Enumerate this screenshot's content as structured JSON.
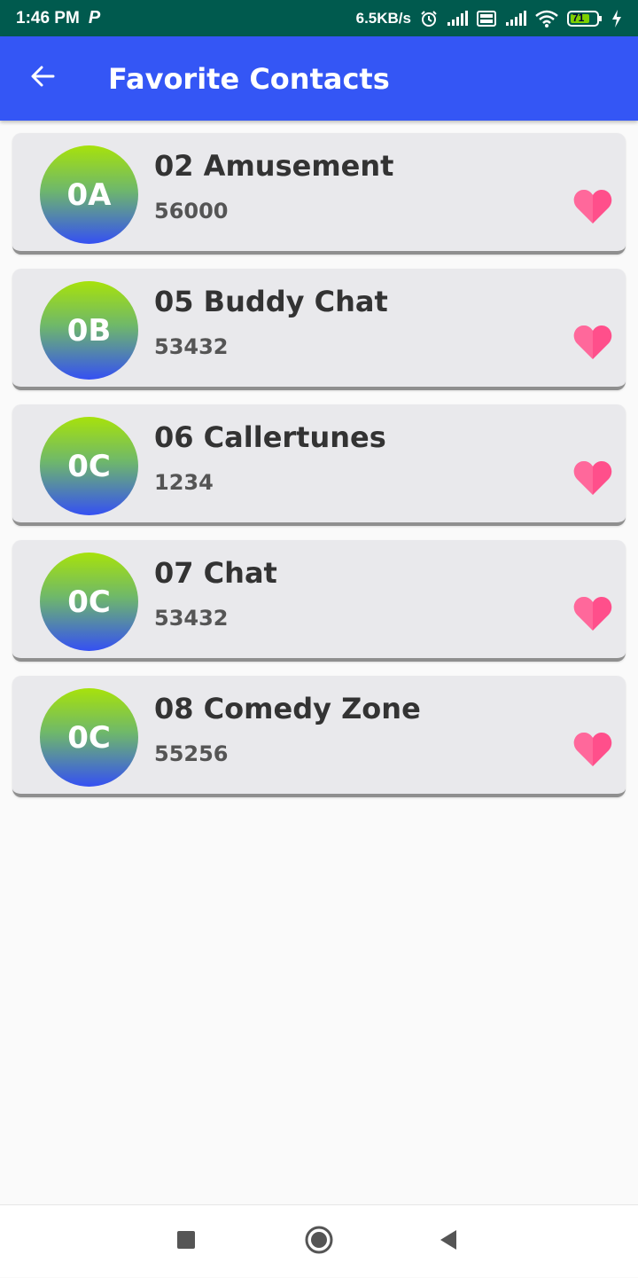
{
  "status_bar": {
    "time": "1:46 PM",
    "p_badge": "P",
    "network_speed": "6.5KB/s",
    "battery": "71",
    "icons": [
      "alarm-icon",
      "signal-icon",
      "volte-icon",
      "signal-icon",
      "wifi-icon",
      "battery-icon",
      "charging-icon"
    ]
  },
  "app_bar": {
    "title": "Favorite Contacts",
    "back_icon": "arrow-left-icon",
    "color": "#3456f5"
  },
  "contacts": [
    {
      "initials": "0A",
      "name": "02 Amusement",
      "number": "56000"
    },
    {
      "initials": "0B",
      "name": "05 Buddy Chat",
      "number": "53432"
    },
    {
      "initials": "0C",
      "name": "06 Callertunes",
      "number": "1234"
    },
    {
      "initials": "0C",
      "name": "07 Chat",
      "number": "53432"
    },
    {
      "initials": "0C",
      "name": "08 Comedy Zone",
      "number": "55256"
    }
  ],
  "favorite_icon": "heart-icon",
  "favorite_color": "#ff4f8b",
  "nav_bar": {
    "icons": [
      "recent-apps-icon",
      "home-icon",
      "back-icon"
    ]
  }
}
